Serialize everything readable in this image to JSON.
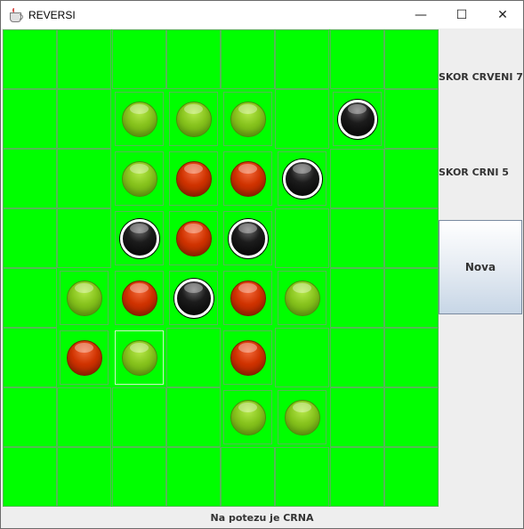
{
  "window": {
    "title": "REVERSI",
    "controls": {
      "minimize": "—",
      "maximize": "☐",
      "close": "✕"
    }
  },
  "board": {
    "rows": 8,
    "cols": 8,
    "colors": {
      "background": "#00ff00",
      "green": "#86c21c",
      "red": "#cf3200",
      "black": "#000000"
    },
    "selected": [
      5,
      2
    ],
    "cells": [
      [
        "",
        "",
        "",
        "",
        "",
        "",
        "",
        ""
      ],
      [
        "",
        "",
        "G",
        "G",
        "G",
        "",
        "B",
        ""
      ],
      [
        "",
        "",
        "G",
        "R",
        "R",
        "B",
        "",
        ""
      ],
      [
        "",
        "",
        "B",
        "R",
        "B",
        "",
        "",
        ""
      ],
      [
        "",
        "G",
        "R",
        "B",
        "R",
        "G",
        "",
        ""
      ],
      [
        "",
        "R",
        "G",
        "",
        "R",
        "",
        "",
        ""
      ],
      [
        "",
        "",
        "",
        "",
        "G",
        "G",
        "",
        ""
      ],
      [
        "",
        "",
        "",
        "",
        "",
        "",
        "",
        ""
      ]
    ]
  },
  "side": {
    "score_red": "SKOR CRVENI 7",
    "score_black": "SKOR CRNI 5",
    "new_button": "Nova"
  },
  "status": {
    "text": "Na potezu je CRNA"
  }
}
